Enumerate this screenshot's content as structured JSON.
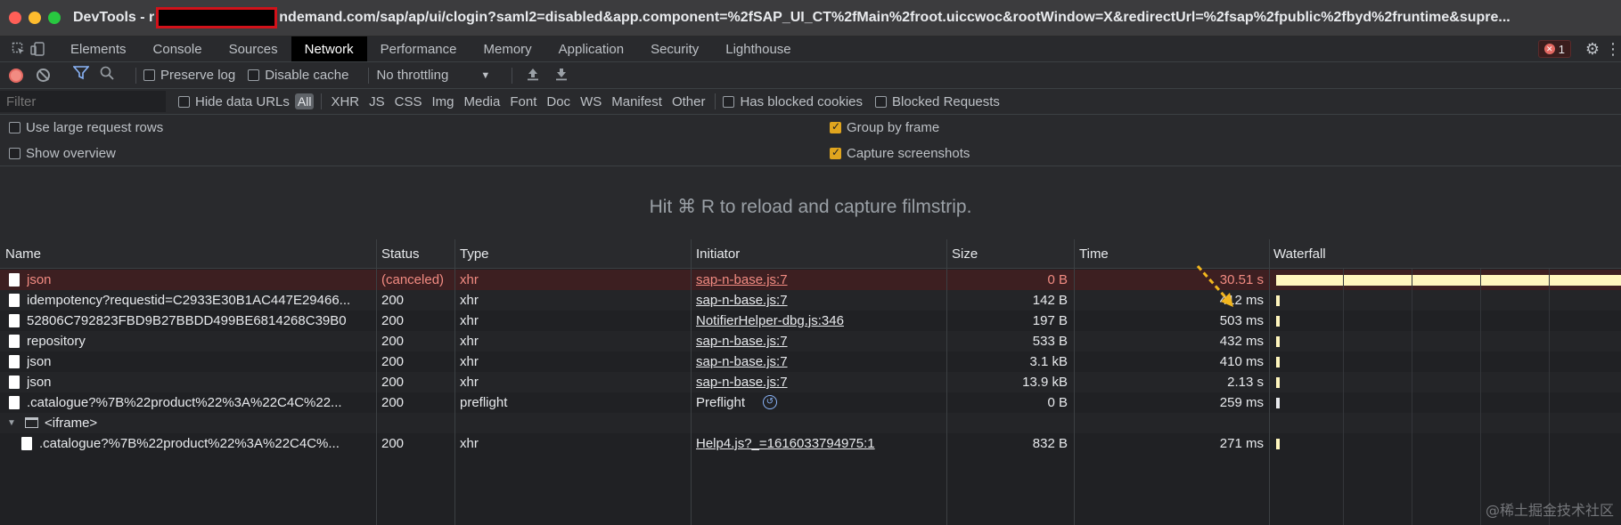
{
  "window": {
    "title_prefix": "DevTools - r",
    "title_url": "ndemand.com/sap/ap/ui/clogin?saml2=disabled&app.component=%2fSAP_UI_CT%2fMain%2froot.uiccwoc&rootWindow=X&redirectUrl=%2fsap%2fpublic%2fbyd%2fruntime&supre..."
  },
  "tabs": [
    {
      "label": "Elements",
      "active": false
    },
    {
      "label": "Console",
      "active": false
    },
    {
      "label": "Sources",
      "active": false
    },
    {
      "label": "Network",
      "active": true
    },
    {
      "label": "Performance",
      "active": false
    },
    {
      "label": "Memory",
      "active": false
    },
    {
      "label": "Application",
      "active": false
    },
    {
      "label": "Security",
      "active": false
    },
    {
      "label": "Lighthouse",
      "active": false
    }
  ],
  "error_count": "1",
  "toolbar": {
    "preserve_log": "Preserve log",
    "disable_cache": "Disable cache",
    "throttling": "No throttling"
  },
  "filter": {
    "placeholder": "Filter",
    "hide_data_urls": "Hide data URLs",
    "all": "All",
    "types": [
      "XHR",
      "JS",
      "CSS",
      "Img",
      "Media",
      "Font",
      "Doc",
      "WS",
      "Manifest",
      "Other"
    ],
    "has_blocked_cookies": "Has blocked cookies",
    "blocked_requests": "Blocked Requests"
  },
  "settings": {
    "large_rows": {
      "label": "Use large request rows",
      "checked": false
    },
    "show_overview": {
      "label": "Show overview",
      "checked": false
    },
    "group_by_frame": {
      "label": "Group by frame",
      "checked": true
    },
    "capture_screenshots": {
      "label": "Capture screenshots",
      "checked": true
    }
  },
  "filmstrip_hint": "Hit ⌘ R to reload and capture filmstrip.",
  "columns": {
    "name": "Name",
    "status": "Status",
    "type": "Type",
    "initiator": "Initiator",
    "size": "Size",
    "time": "Time",
    "waterfall": "Waterfall"
  },
  "rows": [
    {
      "name": "json",
      "status": "(canceled)",
      "type": "xhr",
      "initiator": "sap-n-base.js:7",
      "size": "0 B",
      "time": "30.51 s",
      "error": true,
      "waterfall_fraction": 1.0
    },
    {
      "name": "idempotency?requestid=C2933E30B1AC447E29466...",
      "status": "200",
      "type": "xhr",
      "initiator": "sap-n-base.js:7",
      "size": "142 B",
      "time": "412 ms",
      "error": false,
      "waterfall_fraction": 0.01
    },
    {
      "name": "52806C792823FBD9B27BBDD499BE6814268C39B0",
      "status": "200",
      "type": "xhr",
      "initiator": "NotifierHelper-dbg.js:346",
      "size": "197 B",
      "time": "503 ms",
      "error": false,
      "waterfall_fraction": 0.01
    },
    {
      "name": "repository",
      "status": "200",
      "type": "xhr",
      "initiator": "sap-n-base.js:7",
      "size": "533 B",
      "time": "432 ms",
      "error": false,
      "waterfall_fraction": 0.01
    },
    {
      "name": "json",
      "status": "200",
      "type": "xhr",
      "initiator": "sap-n-base.js:7",
      "size": "3.1 kB",
      "time": "410 ms",
      "error": false,
      "waterfall_fraction": 0.01
    },
    {
      "name": "json",
      "status": "200",
      "type": "xhr",
      "initiator": "sap-n-base.js:7",
      "size": "13.9 kB",
      "time": "2.13 s",
      "error": false,
      "waterfall_fraction": 0.01
    },
    {
      "name": ".catalogue?%7B%22product%22%3A%22C4C%22...",
      "status": "200",
      "type": "preflight",
      "initiator": "Preflight",
      "size": "0 B",
      "time": "259 ms",
      "error": false,
      "waterfall_fraction": 0.01
    }
  ],
  "frame_group": {
    "label": "<iframe>"
  },
  "frame_rows": [
    {
      "name": ".catalogue?%7B%22product%22%3A%22C4C%...",
      "status": "200",
      "type": "xhr",
      "initiator": "Help4.js?_=1616033794975:1",
      "size": "832 B",
      "time": "271 ms",
      "error": false
    }
  ],
  "watermark": "@稀土掘金技术社区"
}
